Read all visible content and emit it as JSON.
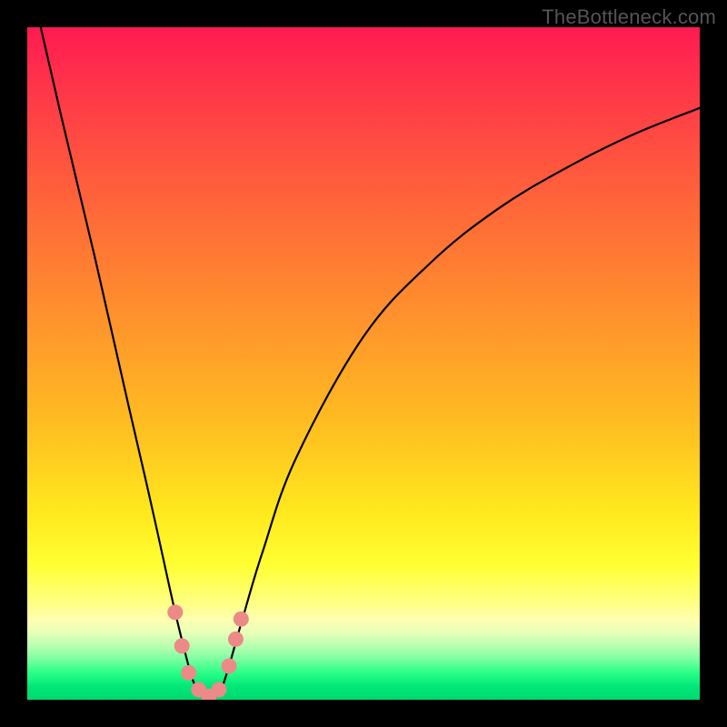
{
  "watermark": "TheBottleneck.com",
  "chart_data": {
    "type": "line",
    "title": "",
    "xlabel": "",
    "ylabel": "",
    "xlim": [
      0,
      100
    ],
    "ylim": [
      0,
      100
    ],
    "series": [
      {
        "name": "bottleneck-curve",
        "x": [
          2,
          5,
          10,
          15,
          18,
          20,
          22,
          24,
          25,
          26,
          27,
          28,
          29,
          30,
          32,
          35,
          40,
          50,
          60,
          70,
          80,
          90,
          100
        ],
        "y": [
          100,
          87,
          66,
          44,
          31,
          22,
          13,
          5,
          2,
          0.5,
          0,
          0.5,
          2,
          5,
          12,
          22,
          36,
          54,
          65,
          73,
          79,
          84,
          88
        ]
      }
    ],
    "markers": {
      "name": "highlight-dots",
      "points": [
        {
          "x": 22.0,
          "y": 13
        },
        {
          "x": 23.0,
          "y": 8
        },
        {
          "x": 24.0,
          "y": 4
        },
        {
          "x": 25.5,
          "y": 1.5
        },
        {
          "x": 27.0,
          "y": 0.5
        },
        {
          "x": 28.5,
          "y": 1.5
        },
        {
          "x": 30.0,
          "y": 5
        },
        {
          "x": 31.0,
          "y": 9
        },
        {
          "x": 31.8,
          "y": 12
        }
      ]
    },
    "gradient_stops": [
      {
        "pct": 0,
        "color": "#ff1a52"
      },
      {
        "pct": 50,
        "color": "#ffba22"
      },
      {
        "pct": 80,
        "color": "#ffff33"
      },
      {
        "pct": 100,
        "color": "#00d86f"
      }
    ]
  }
}
